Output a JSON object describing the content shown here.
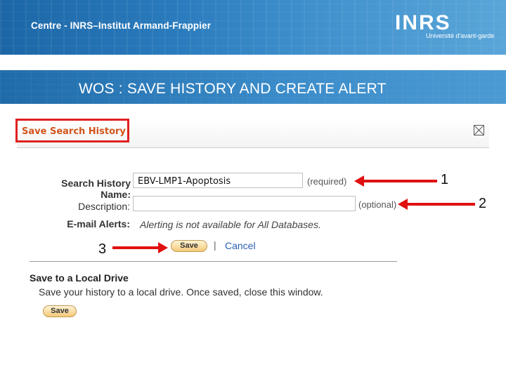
{
  "banner": {
    "text": "Centre - INRS–Institut Armand-Frappier",
    "logo": "INRS",
    "logo_sub": "Université d'avant-garde"
  },
  "slide_title": "WOS : SAVE HISTORY AND CREATE ALERT",
  "dialog": {
    "title": "Save Search History",
    "close_icon": "close-icon",
    "fields": {
      "name_label": "Search History Name:",
      "name_value": "EBV-LMP1-Apoptosis",
      "name_hint": "(required)",
      "description_label": "Description:",
      "description_value": "",
      "description_hint": "(optional)",
      "alerts_label": "E-mail Alerts:",
      "alerts_note": "Alerting is not available for All Databases."
    },
    "save_label": "Save",
    "separator": "|",
    "cancel_label": "Cancel",
    "local": {
      "title": "Save to a Local Drive",
      "text": "Save your history to a local drive. Once saved, close this window.",
      "save_label": "Save"
    }
  },
  "annotations": {
    "num1": "1",
    "num2": "2",
    "num3": "3",
    "arrow_color": "#e01010",
    "highlight_color": "#e02020"
  }
}
